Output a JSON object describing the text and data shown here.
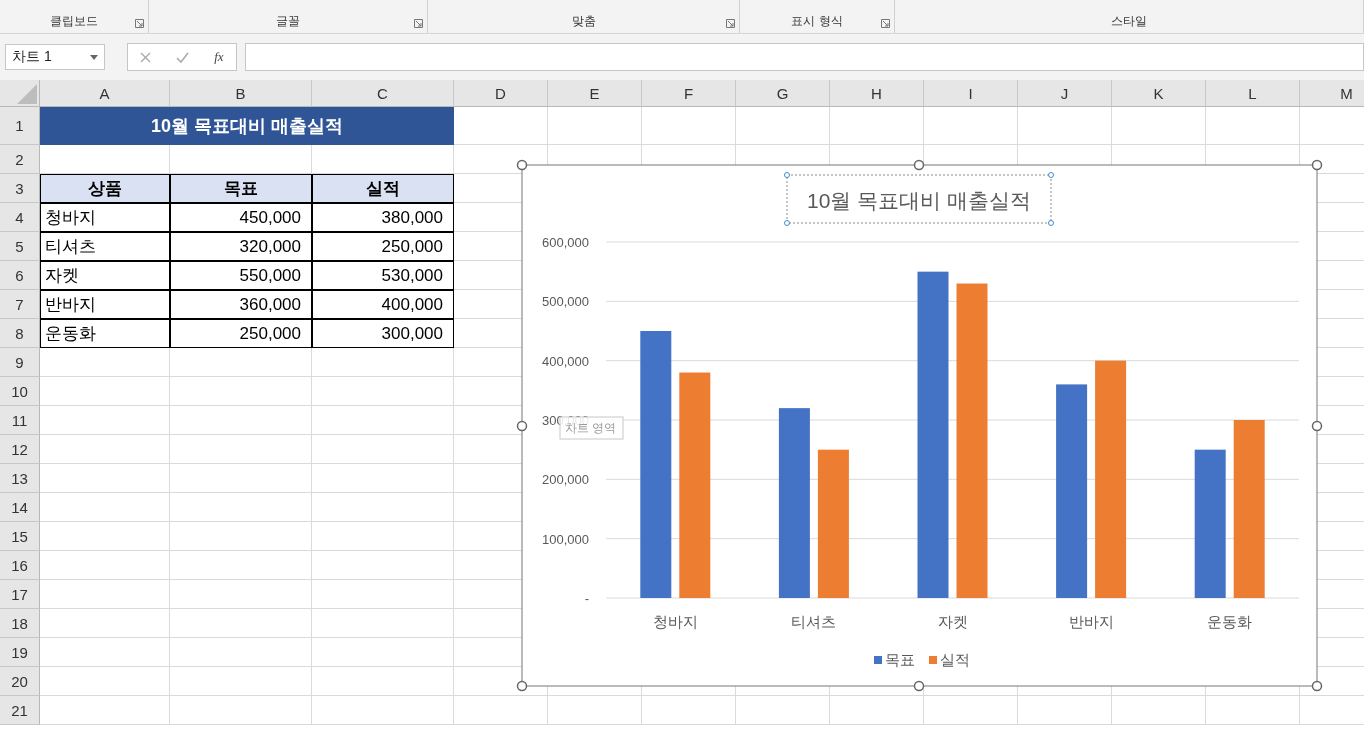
{
  "ribbon_groups": [
    {
      "label": "클립보드",
      "has_launcher": true
    },
    {
      "label": "글꼴",
      "has_launcher": true
    },
    {
      "label": "맞춤",
      "has_launcher": true
    },
    {
      "label": "표시 형식",
      "has_launcher": true
    },
    {
      "label": "스타일",
      "has_launcher": false
    }
  ],
  "name_box": {
    "value": "차트 1"
  },
  "formula_bar": {
    "function_label": "fx"
  },
  "columns": [
    "A",
    "B",
    "C",
    "D",
    "E",
    "F",
    "G",
    "H",
    "I",
    "J",
    "K",
    "L",
    "M"
  ],
  "row_numbers": [
    "1",
    "2",
    "3",
    "4",
    "5",
    "6",
    "7",
    "8",
    "9",
    "10",
    "11",
    "12",
    "13",
    "14",
    "15",
    "16",
    "17",
    "18",
    "19",
    "20",
    "21"
  ],
  "sheet": {
    "title": "10월 목표대비 매출실적",
    "header": [
      "상품",
      "목표",
      "실적"
    ],
    "rows": [
      [
        "청바지",
        "450,000",
        "380,000"
      ],
      [
        "티셔츠",
        "320,000",
        "250,000"
      ],
      [
        "자켓",
        "550,000",
        "530,000"
      ],
      [
        "반바지",
        "360,000",
        "400,000"
      ],
      [
        "운동화",
        "250,000",
        "300,000"
      ]
    ]
  },
  "chart": {
    "selected": true,
    "title": "10월 목표대비 매출실적",
    "tooltip": "차트 영역",
    "chart_data": {
      "type": "bar",
      "categories": [
        "청바지",
        "티셔츠",
        "자켓",
        "반바지",
        "운동화"
      ],
      "series": [
        {
          "name": "목표",
          "color": "#4472c4",
          "values": [
            450000,
            320000,
            550000,
            360000,
            250000
          ]
        },
        {
          "name": "실적",
          "color": "#ed7d31",
          "values": [
            380000,
            250000,
            530000,
            400000,
            300000
          ]
        }
      ],
      "ylim": [
        0,
        600000
      ],
      "grid": true,
      "legend": true,
      "yticks": [
        {
          "value": 0,
          "label": "-"
        },
        {
          "value": 100000,
          "label": "100,000"
        },
        {
          "value": 200000,
          "label": "200,000"
        },
        {
          "value": 300000,
          "label": "300,000"
        },
        {
          "value": 400000,
          "label": "400,000"
        },
        {
          "value": 500000,
          "label": "500,000"
        },
        {
          "value": 600000,
          "label": "600,000"
        }
      ]
    }
  }
}
